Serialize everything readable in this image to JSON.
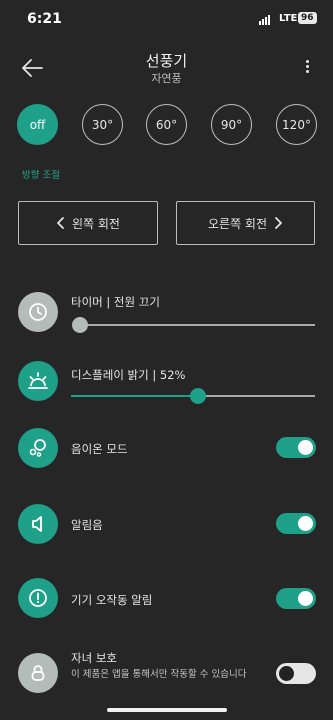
{
  "status_bar": {
    "time": "6:21",
    "network": "LTE",
    "battery": "96"
  },
  "header": {
    "title": "선풍기",
    "subtitle": "자연풍"
  },
  "angles": [
    {
      "label": "off",
      "active": true
    },
    {
      "label": "30°",
      "active": false
    },
    {
      "label": "60°",
      "active": false
    },
    {
      "label": "90°",
      "active": false
    },
    {
      "label": "120°",
      "active": false
    }
  ],
  "direction": {
    "section_label": "방향 조절",
    "left_label": "왼쪽 회전",
    "right_label": "오른쪽 회전"
  },
  "timer": {
    "label": "타이머 | 전원 끄기",
    "level": 0.0
  },
  "display": {
    "label": "디스플레이 밝기 | 52%",
    "level": 0.52
  },
  "eco_mode": {
    "label": "음이온 모드",
    "on": true
  },
  "alarm_sound": {
    "label": "알림음",
    "on": true
  },
  "malfunction_alert": {
    "label": "기기 오작동 알림",
    "on": true
  },
  "child_lock": {
    "label": "자녀 보호",
    "description": "이 제품은 앱을 통해서만 작동할 수 있습니다",
    "on": false
  },
  "colors": {
    "accent": "#1ea089",
    "background": "#262626"
  }
}
